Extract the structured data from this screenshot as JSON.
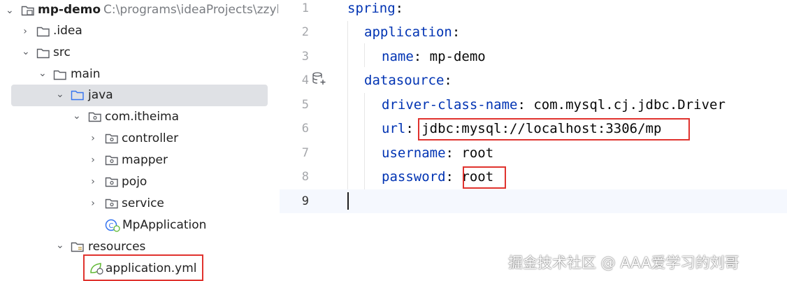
{
  "project": {
    "name": "mp-demo",
    "path": "C:\\programs\\ideaProjects\\zzyl",
    "nodes": [
      {
        "label": "mp-demo",
        "depth": 0,
        "expanded": true,
        "kind": "module"
      },
      {
        "label": ".idea",
        "depth": 1,
        "expanded": false,
        "kind": "folder"
      },
      {
        "label": "src",
        "depth": 1,
        "expanded": true,
        "kind": "folder"
      },
      {
        "label": "main",
        "depth": 2,
        "expanded": true,
        "kind": "folder"
      },
      {
        "label": "java",
        "depth": 3,
        "expanded": true,
        "kind": "source-folder"
      },
      {
        "label": "com.itheima",
        "depth": 4,
        "expanded": true,
        "kind": "package"
      },
      {
        "label": "controller",
        "depth": 5,
        "expanded": false,
        "kind": "package"
      },
      {
        "label": "mapper",
        "depth": 5,
        "expanded": false,
        "kind": "package"
      },
      {
        "label": "pojo",
        "depth": 5,
        "expanded": false,
        "kind": "package"
      },
      {
        "label": "service",
        "depth": 5,
        "expanded": false,
        "kind": "package"
      },
      {
        "label": "MpApplication",
        "depth": 5,
        "kind": "spring-class"
      },
      {
        "label": "resources",
        "depth": 3,
        "expanded": true,
        "kind": "resources-folder"
      },
      {
        "label": "application.yml",
        "depth": 4,
        "kind": "yaml-file"
      }
    ],
    "selected": "java",
    "highlighted": "application.yml"
  },
  "editor": {
    "lines": [
      {
        "n": "1",
        "key": "spring",
        "sep": ":",
        "value": ""
      },
      {
        "n": "2",
        "key": "application",
        "sep": ":",
        "value": ""
      },
      {
        "n": "3",
        "key": "name",
        "sep": ": ",
        "value": "mp-demo"
      },
      {
        "n": "4",
        "key": "datasource",
        "sep": ":",
        "value": ""
      },
      {
        "n": "5",
        "key": "driver-class-name",
        "sep": ": ",
        "value": "com.mysql.cj.jdbc.Driver"
      },
      {
        "n": "6",
        "key": "url",
        "sep": ": ",
        "value": "jdbc:mysql://localhost:3306/mp"
      },
      {
        "n": "7",
        "key": "username",
        "sep": ": ",
        "value": "root"
      },
      {
        "n": "8",
        "key": "password",
        "sep": ": ",
        "value": "root"
      },
      {
        "n": "9",
        "key": "",
        "sep": "",
        "value": ""
      }
    ],
    "current_line": "9",
    "gutter_icon_line": "4",
    "colors": {
      "key": "#0033b3",
      "value": "#080808",
      "highlight": "#e0332e"
    }
  },
  "watermark": "掘金技术社区 @ AAA爱学习的刘哥"
}
